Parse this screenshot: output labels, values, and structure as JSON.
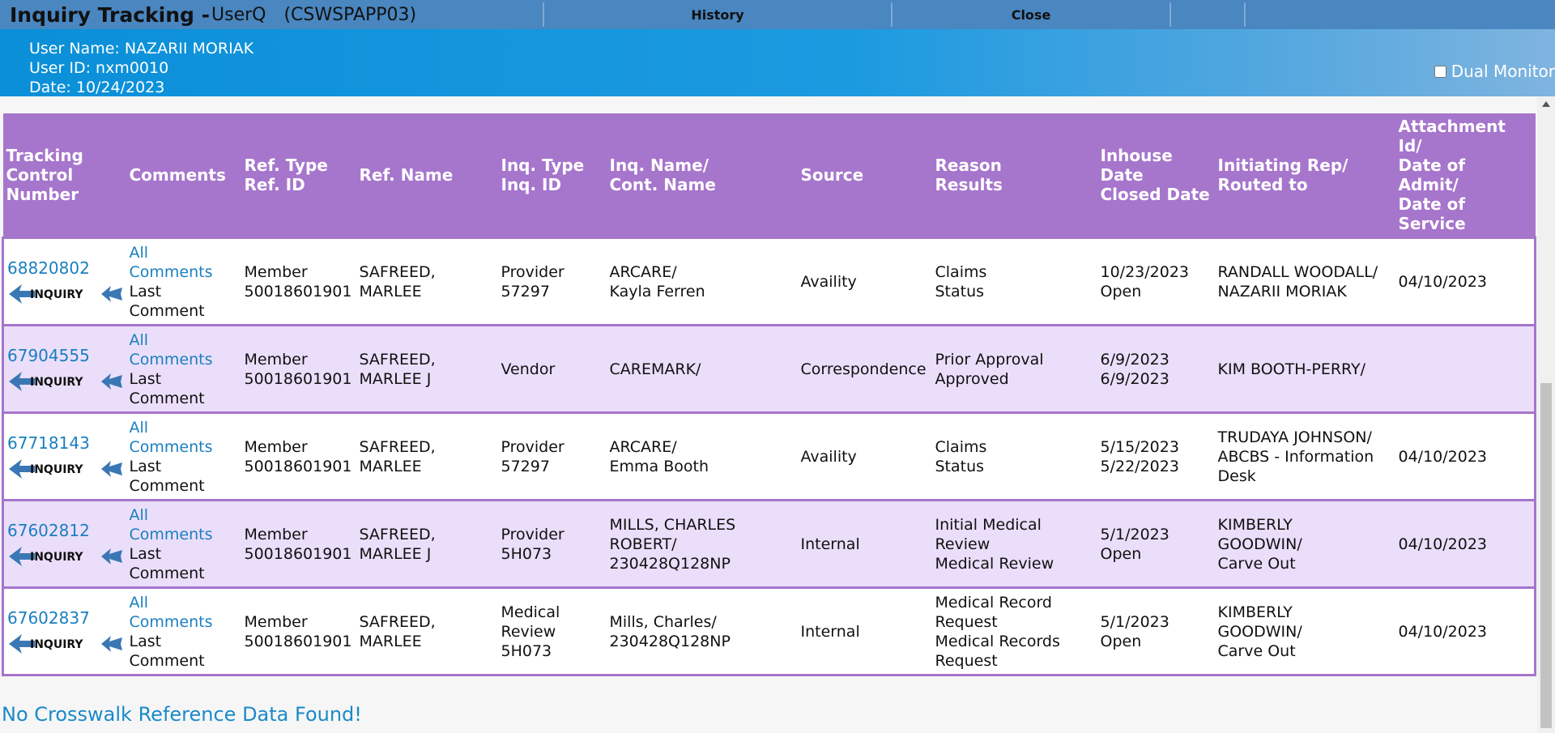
{
  "app": {
    "title": "Inquiry Tracking -",
    "user_code": "UserQ",
    "host": "(CSWSPAPP03)"
  },
  "toolbar": {
    "history_label": "History",
    "close_label": "Close"
  },
  "user": {
    "name_line": "User Name: NAZARII MORIAK",
    "id_line": "User ID: nxm0010",
    "date_line": "Date: 10/24/2023",
    "dual_monitor_label": "Dual Monitor"
  },
  "columns": {
    "tracking": [
      "Tracking",
      "Control",
      "Number"
    ],
    "comments": [
      "Comments"
    ],
    "ref_type": [
      "Ref. Type",
      "Ref. ID"
    ],
    "ref_name": [
      "Ref. Name"
    ],
    "inq_type": [
      "Inq. Type",
      "Inq. ID"
    ],
    "inq_name": [
      "Inq. Name/",
      "Cont. Name"
    ],
    "source": [
      "Source"
    ],
    "reason": [
      "Reason",
      "Results"
    ],
    "inhouse": [
      "Inhouse",
      "Date",
      "Closed Date"
    ],
    "rep": [
      "Initiating Rep/",
      "Routed to"
    ],
    "attachment": [
      "Attachment",
      "Id/",
      "Date of",
      "Admit/",
      "Date of",
      "Service"
    ]
  },
  "comments_labels": {
    "all": [
      "All",
      "Comments"
    ],
    "last": [
      "Last",
      "Comment"
    ]
  },
  "logo_text": "INQUIRY",
  "rows": [
    {
      "tcn": "68820802",
      "ref": [
        "Member",
        "50018601901"
      ],
      "ref_name": [
        "SAFREED,",
        "MARLEE"
      ],
      "inq_type": [
        "Provider",
        "57297"
      ],
      "inq_name": [
        "ARCARE/",
        "Kayla Ferren"
      ],
      "source": "Availity",
      "reason": [
        "Claims",
        "Status"
      ],
      "inhouse": [
        "10/23/2023",
        "Open"
      ],
      "rep": [
        "RANDALL WOODALL/",
        "NAZARII MORIAK"
      ],
      "attachment": "04/10/2023",
      "style": "norm"
    },
    {
      "tcn": "67904555",
      "ref": [
        "Member",
        "50018601901"
      ],
      "ref_name": [
        "SAFREED,",
        "MARLEE J"
      ],
      "inq_type": [
        "Vendor"
      ],
      "inq_name": [
        "CAREMARK/"
      ],
      "source": "Correspondence",
      "reason": [
        "Prior Approval",
        "Approved"
      ],
      "inhouse": [
        "6/9/2023",
        "6/9/2023"
      ],
      "rep": [
        "KIM BOOTH-PERRY/"
      ],
      "attachment": "",
      "style": "alt"
    },
    {
      "tcn": "67718143",
      "ref": [
        "Member",
        "50018601901"
      ],
      "ref_name": [
        "SAFREED,",
        "MARLEE"
      ],
      "inq_type": [
        "Provider",
        "57297"
      ],
      "inq_name": [
        "ARCARE/",
        "Emma Booth"
      ],
      "source": "Availity",
      "reason": [
        "Claims",
        "Status"
      ],
      "inhouse": [
        "5/15/2023",
        "5/22/2023"
      ],
      "rep": [
        "TRUDAYA JOHNSON/",
        "ABCBS - Information",
        "Desk"
      ],
      "attachment": "04/10/2023",
      "style": "norm"
    },
    {
      "tcn": "67602812",
      "ref": [
        "Member",
        "50018601901"
      ],
      "ref_name": [
        "SAFREED,",
        "MARLEE J"
      ],
      "inq_type": [
        "Provider",
        "5H073"
      ],
      "inq_name": [
        "MILLS, CHARLES",
        "ROBERT/",
        "230428Q128NP"
      ],
      "source": "Internal",
      "reason": [
        "Initial Medical",
        "Review",
        "Medical Review"
      ],
      "inhouse": [
        "5/1/2023",
        "Open"
      ],
      "rep": [
        "KIMBERLY",
        "GOODWIN/",
        "Carve Out"
      ],
      "attachment": "04/10/2023",
      "style": "alt"
    },
    {
      "tcn": "67602837",
      "ref": [
        "Member",
        "50018601901"
      ],
      "ref_name": [
        "SAFREED,",
        "MARLEE"
      ],
      "inq_type": [
        "Medical",
        "Review",
        "5H073"
      ],
      "inq_name": [
        "Mills, Charles/",
        "230428Q128NP"
      ],
      "source": "Internal",
      "reason": [
        "Medical Record",
        "Request",
        "Medical Records",
        "Request"
      ],
      "inhouse": [
        "5/1/2023",
        "Open"
      ],
      "rep": [
        "KIMBERLY",
        "GOODWIN/",
        "Carve Out"
      ],
      "attachment": "04/10/2023",
      "style": "norm"
    }
  ],
  "footer": {
    "no_data": "No Crosswalk Reference Data Found!"
  },
  "colors": {
    "titlebar": "#4a86c0",
    "header_band": "#0a8fd8",
    "grid_header": "#a675cc",
    "alt_row": "#ebdefa",
    "link": "#1a7fc0"
  }
}
